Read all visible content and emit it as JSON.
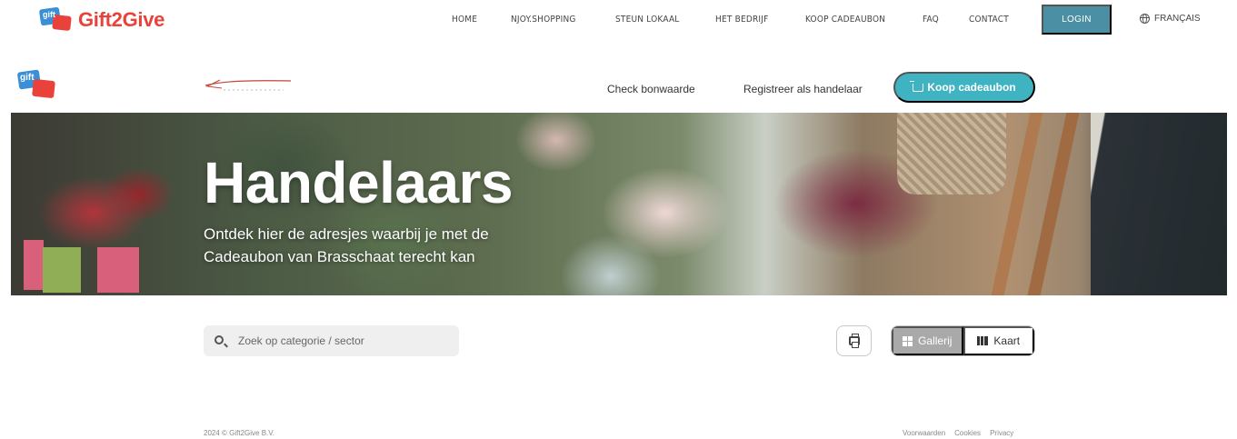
{
  "brand": {
    "name": "Gift2Give",
    "logo_text": "gift"
  },
  "nav": {
    "items": [
      {
        "label": "HOME"
      },
      {
        "label": "NJOY.SHOPPING"
      },
      {
        "label": "STEUN LOKAAL"
      },
      {
        "label": "HET BEDRIJF"
      },
      {
        "label": "KOOP CADEAUBON"
      },
      {
        "label": "FAQ"
      },
      {
        "label": "CONTACT"
      }
    ],
    "login_label": "LOGIN",
    "language_label": "FRANÇAIS",
    "language_icon": "globe-icon",
    "accent_color": "#4a8fa3"
  },
  "subnav": {
    "logo_text": "gift",
    "check_label": "Check bonwaarde",
    "register_label": "Registreer als handelaar",
    "cta_label": "Koop cadeaubon",
    "cta_icon": "cart-icon",
    "cta_color": "#3fb3c2"
  },
  "hero": {
    "title": "Handelaars",
    "subtitle": "Ontdek hier de adresjes waarbij je met de Cadeaubon van Brasschaat terecht kan"
  },
  "toolbar": {
    "search_placeholder": "Zoek op categorie / sector",
    "search_value": "",
    "search_icon": "search-icon",
    "print_icon": "printer-icon",
    "view_options": [
      {
        "label": "Gallerij",
        "icon": "grid-icon",
        "active": true
      },
      {
        "label": "Kaart",
        "icon": "map-icon",
        "active": false
      }
    ]
  },
  "footer": {
    "copyright": "2024 © Gift2Give B.V.",
    "links": [
      "Voorwaarden",
      "Cookies",
      "Privacy"
    ]
  }
}
